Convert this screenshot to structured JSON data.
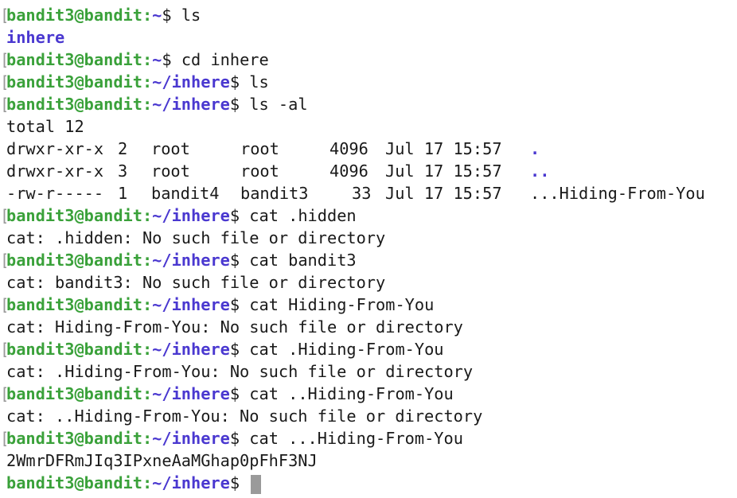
{
  "prompt": {
    "open_bracket": "[",
    "user_host": "bandit3@bandit",
    "sep": ":",
    "home_path": "~",
    "inhere_path": "~/inhere",
    "dollar": "$"
  },
  "commands": {
    "c0": "ls",
    "c1": "cd inhere",
    "c2": "ls",
    "c3": "ls -al",
    "c4": "cat .hidden",
    "c5": "cat bandit3",
    "c6": "cat Hiding-From-You",
    "c7": "cat .Hiding-From-You",
    "c8": "cat ..Hiding-From-You",
    "c9": "cat ...Hiding-From-You"
  },
  "outputs": {
    "ls_result": "inhere",
    "total": "total 12",
    "err_hidden": "cat: .hidden: No such file or directory",
    "err_bandit3": "cat: bandit3: No such file or directory",
    "err_hiding": "cat: Hiding-From-You: No such file or directory",
    "err_dot_hiding": "cat: .Hiding-From-You: No such file or directory",
    "err_dotdot_hiding": "cat: ..Hiding-From-You: No such file or directory",
    "password": "2WmrDFRmJIq3IPxneAaMGhap0pFhF3NJ"
  },
  "listing": [
    {
      "perms": "drwxr-xr-x",
      "links": "2",
      "owner": "root",
      "group": "root",
      "size": "4096",
      "date": "Jul 17 15:57",
      "name": "."
    },
    {
      "perms": "drwxr-xr-x",
      "links": "3",
      "owner": "root",
      "group": "root",
      "size": "4096",
      "date": "Jul 17 15:57",
      "name": ".."
    },
    {
      "perms": "-rw-r-----",
      "links": "1",
      "owner": "bandit4",
      "group": "bandit3",
      "size": "33",
      "date": "Jul 17 15:57",
      "name": "...Hiding-From-You"
    }
  ],
  "colors": {
    "prompt_user": "#3aa13a",
    "prompt_path": "#4a38d0",
    "directory": "#4a38d0",
    "text": "#1a1a1a",
    "cursor": "#9a9a9a",
    "background": "#ffffff"
  }
}
